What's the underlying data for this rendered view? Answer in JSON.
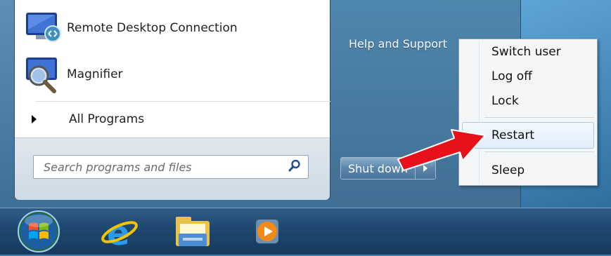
{
  "start_menu": {
    "programs": [
      {
        "label": "Remote Desktop Connection",
        "icon": "remote-desktop-icon"
      },
      {
        "label": "Magnifier",
        "icon": "magnifier-icon"
      }
    ],
    "all_programs_label": "All Programs",
    "search": {
      "placeholder": "Search programs and files",
      "icon": "search-icon"
    },
    "right_pane": {
      "help_link": "Help and Support"
    },
    "shutdown": {
      "label": "Shut down",
      "arrow_icon": "chevron-right-icon"
    }
  },
  "shutdown_menu": {
    "items": [
      "Switch user",
      "Log off",
      "Lock",
      "Restart",
      "Sleep"
    ],
    "highlighted": "Restart"
  },
  "annotation": {
    "arrow_color": "#e8101a"
  },
  "taskbar": {
    "icons": [
      "start-orb-icon",
      "internet-explorer-icon",
      "file-explorer-icon",
      "media-player-icon"
    ]
  },
  "colors": {
    "accent": "#4a7ca3",
    "menu_highlight": "#a8cbe9"
  }
}
